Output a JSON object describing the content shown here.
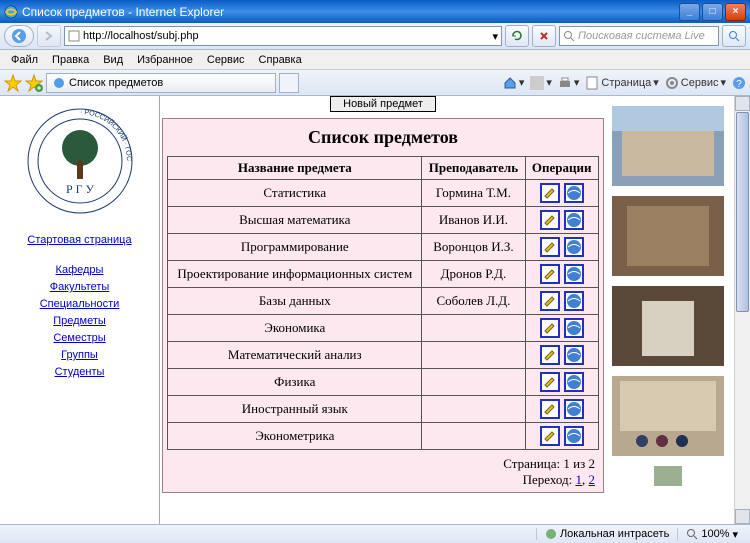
{
  "window": {
    "title": "Список предметов - Internet Explorer"
  },
  "address": {
    "url": "http://localhost/subj.php"
  },
  "search": {
    "placeholder": "Поисковая система Live"
  },
  "menu": {
    "file": "Файл",
    "edit": "Правка",
    "view": "Вид",
    "favorites": "Избранное",
    "tools": "Сервис",
    "help": "Справка"
  },
  "tab": {
    "title": "Список предметов"
  },
  "toolbar": {
    "page": "Страница",
    "service": "Сервис"
  },
  "sidebar": {
    "start": "Стартовая страница",
    "links": [
      "Кафедры",
      "Факультеты",
      "Специальности",
      "Предметы",
      "Семестры",
      "Группы",
      "Студенты"
    ]
  },
  "content": {
    "new_button": "Новый предмет",
    "heading": "Список предметов",
    "columns": {
      "name": "Название предмета",
      "teacher": "Преподаватель",
      "ops": "Операции"
    },
    "rows": [
      {
        "name": "Статистика",
        "teacher": "Гормина Т.М."
      },
      {
        "name": "Высшая математика",
        "teacher": "Иванов И.И."
      },
      {
        "name": "Программирование",
        "teacher": "Воронцов И.З."
      },
      {
        "name": "Проектирование информационных систем",
        "teacher": "Дронов Р.Д."
      },
      {
        "name": "Базы данных",
        "teacher": "Соболев Л.Д."
      },
      {
        "name": "Экономика",
        "teacher": ""
      },
      {
        "name": "Математический анализ",
        "teacher": ""
      },
      {
        "name": "Физика",
        "teacher": ""
      },
      {
        "name": "Иностранный язык",
        "teacher": ""
      },
      {
        "name": "Эконометрика",
        "teacher": ""
      }
    ],
    "pager": {
      "info": "Страница: 1 из 2",
      "goto": "Переход:",
      "p1": "1",
      "p2": "2"
    }
  },
  "status": {
    "zone": "Локальная интрасеть",
    "zoom": "100%"
  }
}
